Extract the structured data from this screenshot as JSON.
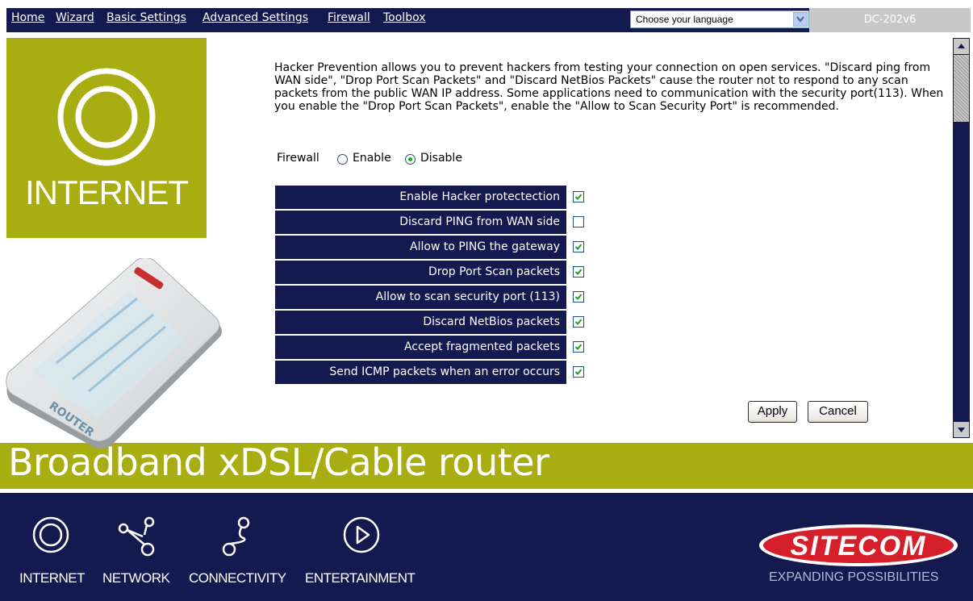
{
  "nav": {
    "items": [
      "Home",
      "Wizard",
      "Basic Settings",
      "Advanced Settings",
      "Firewall",
      "Toolbox"
    ],
    "language_select": "Choose your language",
    "model": "DC-202v6"
  },
  "sidebar": {
    "tile_label": "INTERNET"
  },
  "main": {
    "description": "Hacker Prevention allows you to prevent hackers from testing your connection on open services. \"Discard ping from WAN side\", \"Drop Port Scan Packets\" and \"Discard NetBios Packets\" cause the router not to respond to any scan packets from the public WAN IP address. Some applications need to communication with the security port(113). When you enable the \"Drop Port Scan Packets\", enable the \"Allow to Scan Security Port\" is recommended.",
    "firewall": {
      "label": "Firewall",
      "enable_label": "Enable",
      "disable_label": "Disable",
      "selected": "Disable"
    },
    "options": [
      {
        "label": "Enable Hacker protectection",
        "checked": true
      },
      {
        "label": "Discard PING from WAN side",
        "checked": false
      },
      {
        "label": "Allow to PING the gateway",
        "checked": true
      },
      {
        "label": "Drop Port Scan packets",
        "checked": true
      },
      {
        "label": "Allow to scan security port (113)",
        "checked": true
      },
      {
        "label": "Discard NetBios packets",
        "checked": true
      },
      {
        "label": "Accept fragmented packets",
        "checked": true
      },
      {
        "label": "Send ICMP packets when an error occurs",
        "checked": true
      }
    ],
    "apply_label": "Apply",
    "cancel_label": "Cancel"
  },
  "banner": {
    "title": "Broadband xDSL/Cable router"
  },
  "footer": {
    "categories": [
      "INTERNET",
      "NETWORK",
      "CONNECTIVITY",
      "ENTERTAINMENT"
    ],
    "brand": "SITECOM",
    "tagline": "EXPANDING POSSIBILITIES"
  },
  "colors": {
    "navy": "#141a4f",
    "olive": "#a8ae12",
    "check": "#21a121"
  },
  "icons": [
    "chevron-down-icon",
    "internet-ring-icon",
    "network-icon",
    "connectivity-icon",
    "play-icon",
    "checkmark-icon",
    "scroll-up-icon",
    "scroll-down-icon"
  ]
}
